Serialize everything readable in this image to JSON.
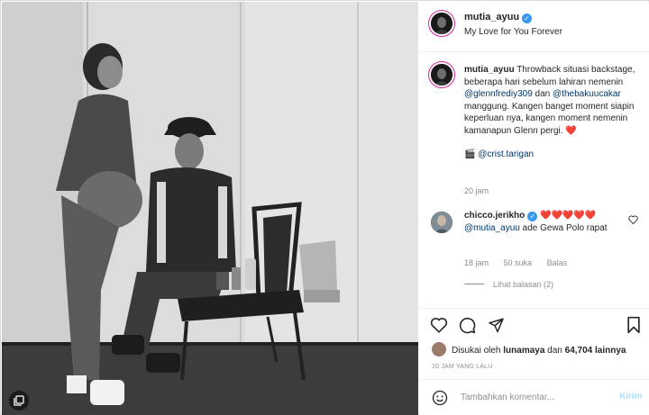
{
  "header": {
    "username": "mutia_ayuu",
    "subtitle": "My Love for You Forever"
  },
  "caption": {
    "username": "mutia_ayuu",
    "text_1": "Throwback situasi backstage, beberapa hari sebelum lahiran nemenin ",
    "mention_1": "@glennfrediy309",
    "text_2": " dan ",
    "mention_2": "@thebakuucakar",
    "text_3": " manggung. Kangen banget moment siapin keperluan nya, kangen moment nemenin kamanapun Glenn pergi. ",
    "heart": "❤️",
    "credit_icon": "🎬",
    "credit": "@crist.tarigan",
    "time": "20 jam"
  },
  "comment": {
    "username": "chicco.jerikho",
    "hearts": "❤️❤️❤️❤️❤️",
    "mention": "@mutia_ayuu",
    "text": " ade Gewa Polo rapat",
    "time": "18 jam",
    "likes": "50 suka",
    "reply": "Balas",
    "view_replies": "Lihat balasan (2)"
  },
  "likes": {
    "prefix": "Disukai oleh ",
    "user": "lunamaya",
    "middle": " dan ",
    "count": "64,704 lainnya"
  },
  "posted_ago": "20 JAM YANG LALU",
  "add_comment": {
    "placeholder": "Tambahkan komentar...",
    "post": "Kirim"
  },
  "colors": {
    "link": "#00376b",
    "verified": "#3897f0",
    "heart": "#ed4956",
    "muted": "#8e8e8e",
    "post_disabled": "#b2dffc"
  },
  "icons": [
    "heart-icon",
    "comment-icon",
    "share-icon",
    "bookmark-icon",
    "emoji-icon",
    "verified-icon",
    "multi-photo-icon"
  ]
}
